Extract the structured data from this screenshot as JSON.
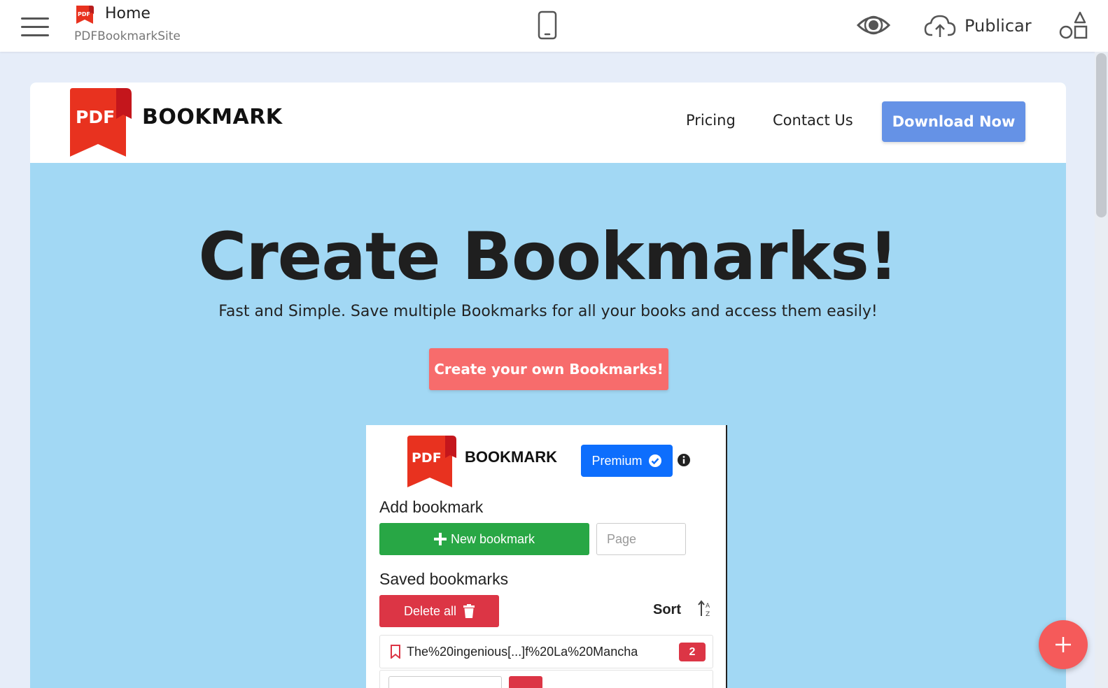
{
  "editor": {
    "title": "Home",
    "subtitle": "PDFBookmarkSite",
    "publish_label": "Publicar",
    "icons": [
      "menu-icon",
      "pdf-logo-icon",
      "mobile-preview-icon",
      "preview-eye-icon",
      "cloud-upload-icon",
      "blocks-icon",
      "add-icon"
    ]
  },
  "site": {
    "logo_badge": "PDF",
    "logo_text": "BOOKMARK",
    "nav": {
      "pricing": "Pricing",
      "contact": "Contact Us",
      "download": "Download Now"
    },
    "hero": {
      "title": "Create Bookmarks!",
      "subtitle": "Fast and Simple. Save multiple Bookmarks for all your books and access them easily!",
      "cta": "Create your own Bookmarks!"
    },
    "colors": {
      "hero_bg": "#a2d8f4",
      "download_btn": "#6592e6",
      "cta_btn": "#f76c6c",
      "logo_red": "#e8321f"
    }
  },
  "extension": {
    "logo_badge": "PDF",
    "logo_text": "BOOKMARK",
    "premium_label": "Premium",
    "add_heading": "Add bookmark",
    "new_bookmark_label": "New bookmark",
    "page_placeholder": "Page",
    "saved_heading": "Saved bookmarks",
    "delete_all_label": "Delete all",
    "sort_label": "Sort",
    "bookmarks": [
      {
        "title": "The%20ingenious[...]f%20La%20Mancha",
        "count": "2"
      }
    ]
  }
}
